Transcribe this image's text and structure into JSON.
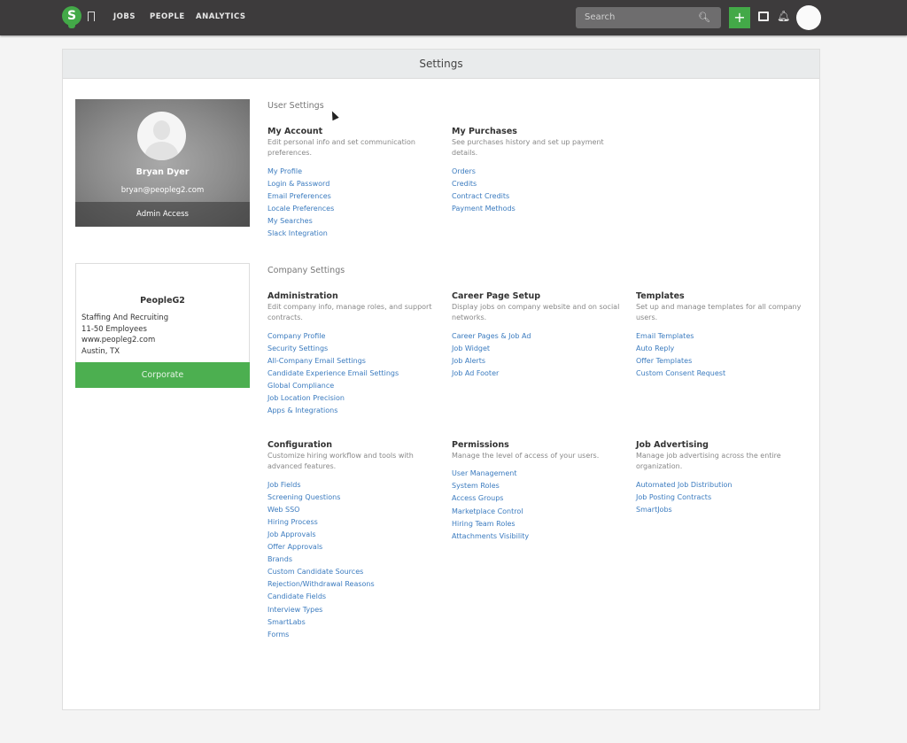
{
  "topbar": {
    "logo_letter": "S",
    "nav": [
      "JOBS",
      "PEOPLE",
      "ANALYTICS"
    ],
    "search_placeholder": "Search",
    "add_label": "+"
  },
  "page_title": "Settings",
  "profile": {
    "name": "Bryan Dyer",
    "email": "bryan@peopleg2.com",
    "access": "Admin Access"
  },
  "company": {
    "name": "PeopleG2",
    "industry": "Staffing And Recruiting",
    "size": "11-50 Employees",
    "website": "www.peopleg2.com",
    "location": "Austin, TX",
    "tier": "Corporate"
  },
  "user_settings": {
    "title": "User Settings",
    "groups": [
      {
        "title": "My Account",
        "desc": "Edit personal info and set communication preferences.",
        "links": [
          "My Profile",
          "Login & Password",
          "Email Preferences",
          "Locale Preferences",
          "My Searches",
          "Slack Integration"
        ]
      },
      {
        "title": "My Purchases",
        "desc": "See purchases history and set up payment details.",
        "links": [
          "Orders",
          "Credits",
          "Contract Credits",
          "Payment Methods"
        ]
      }
    ]
  },
  "company_settings": {
    "title": "Company Settings",
    "rows": [
      [
        {
          "title": "Administration",
          "desc": "Edit company info, manage roles, and support contracts.",
          "links": [
            "Company Profile",
            "Security Settings",
            "All-Company Email Settings",
            "Candidate Experience Email Settings",
            "Global Compliance",
            "Job Location Precision",
            "Apps & Integrations"
          ]
        },
        {
          "title": "Career Page Setup",
          "desc": "Display jobs on company website and on social networks.",
          "links": [
            "Career Pages & Job Ad",
            "Job Widget",
            "Job Alerts",
            "Job Ad Footer"
          ]
        },
        {
          "title": "Templates",
          "desc": "Set up and manage templates for all company users.",
          "links": [
            "Email Templates",
            "Auto Reply",
            "Offer Templates",
            "Custom Consent Request"
          ]
        }
      ],
      [
        {
          "title": "Configuration",
          "desc": "Customize hiring workflow and tools with advanced features.",
          "links": [
            "Job Fields",
            "Screening Questions",
            "Web SSO",
            "Hiring Process",
            "Job Approvals",
            "Offer Approvals",
            "Brands",
            "Custom Candidate Sources",
            "Rejection/Withdrawal Reasons",
            "Candidate Fields",
            "Interview Types",
            "SmartLabs",
            "Forms"
          ]
        },
        {
          "title": "Permissions",
          "desc": "Manage the level of access of your users.",
          "links": [
            "User Management",
            "System Roles",
            "Access Groups",
            "Marketplace Control",
            "Hiring Team Roles",
            "Attachments Visibility"
          ]
        },
        {
          "title": "Job Advertising",
          "desc": "Manage job advertising across the entire organization.",
          "links": [
            "Automated Job Distribution",
            "Job Posting Contracts",
            "SmartJobs"
          ]
        }
      ]
    ]
  }
}
